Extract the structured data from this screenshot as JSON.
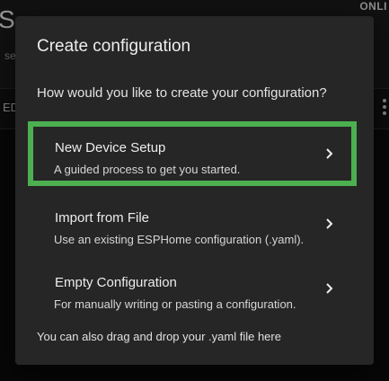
{
  "background": {
    "title": "S",
    "subtitle": "se",
    "status": "ONLI",
    "toolbar_label": "ED"
  },
  "dialog": {
    "title": "Create configuration",
    "question": "How would you like to create your configuration?",
    "options": [
      {
        "title": "New Device Setup",
        "description": "A guided process to get you started.",
        "icon": "chevron-right-icon",
        "highlighted": true
      },
      {
        "title": "Import from File",
        "description": "Use an existing ESPHome configuration (.yaml).",
        "icon": "chevron-right-icon",
        "highlighted": false
      },
      {
        "title": "Empty Configuration",
        "description": "For manually writing or pasting a configuration.",
        "icon": "chevron-right-icon",
        "highlighted": false
      }
    ],
    "footer": "You can also drag and drop your .yaml file here"
  },
  "colors": {
    "dialog_background": "#262626",
    "highlight_border": "#4caf50",
    "text_primary": "#ececec"
  }
}
